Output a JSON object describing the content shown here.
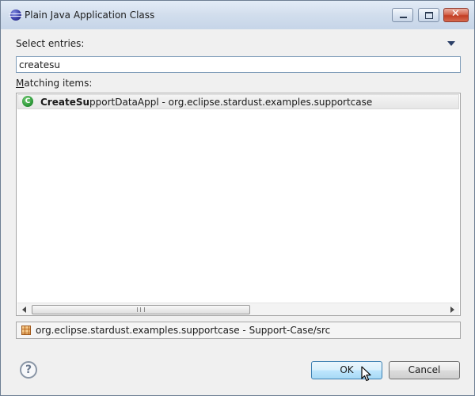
{
  "window": {
    "title": "Plain Java Application Class",
    "controls": {
      "minimize_icon": "minimize-icon",
      "maximize_icon": "maximize-icon",
      "close_glyph": "✕"
    }
  },
  "select_label": "Select entries:",
  "search": {
    "value": "createsu"
  },
  "matching": {
    "prefix": "M",
    "rest": "atching items:"
  },
  "results": [
    {
      "icon": "class-icon",
      "icon_glyph": "C",
      "match": "CreateSu",
      "name_rest": "pportDataAppl",
      "package": " - org.eclipse.stardust.examples.supportcase"
    }
  ],
  "status": {
    "icon": "package-icon",
    "text": "org.eclipse.stardust.examples.supportcase - Support-Case/src"
  },
  "help_glyph": "?",
  "buttons": {
    "ok": "OK",
    "cancel": "Cancel"
  },
  "colors": {
    "title_gradient_top": "#e3ecf7",
    "ok_border": "#3c7fb1",
    "close_red": "#c23e24",
    "class_green": "#2f9a3b"
  }
}
